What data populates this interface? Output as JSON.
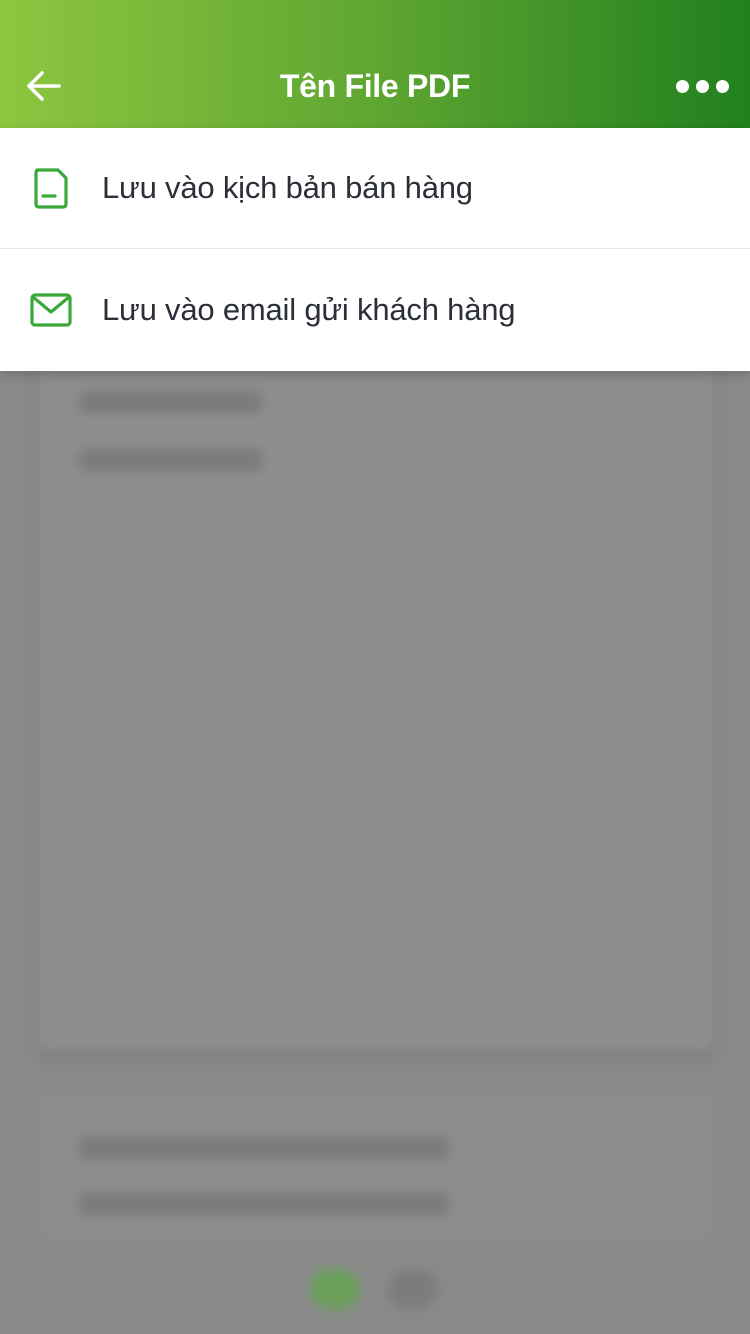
{
  "header": {
    "title": "Tên File PDF",
    "back_icon": "arrow-left-icon",
    "more_icon": "more-dots-icon"
  },
  "menu": {
    "items": [
      {
        "label": "Lưu vào kịch bản bán hàng",
        "icon": "document-icon"
      },
      {
        "label": "Lưu vào email gửi khách hàng",
        "icon": "mail-icon"
      }
    ]
  },
  "colors": {
    "header_gradient_start": "#8dc63f",
    "header_gradient_end": "#22801e",
    "icon_green": "#3aa83a",
    "text_dark": "#2b2f38",
    "overlay_gray": "#888888"
  }
}
